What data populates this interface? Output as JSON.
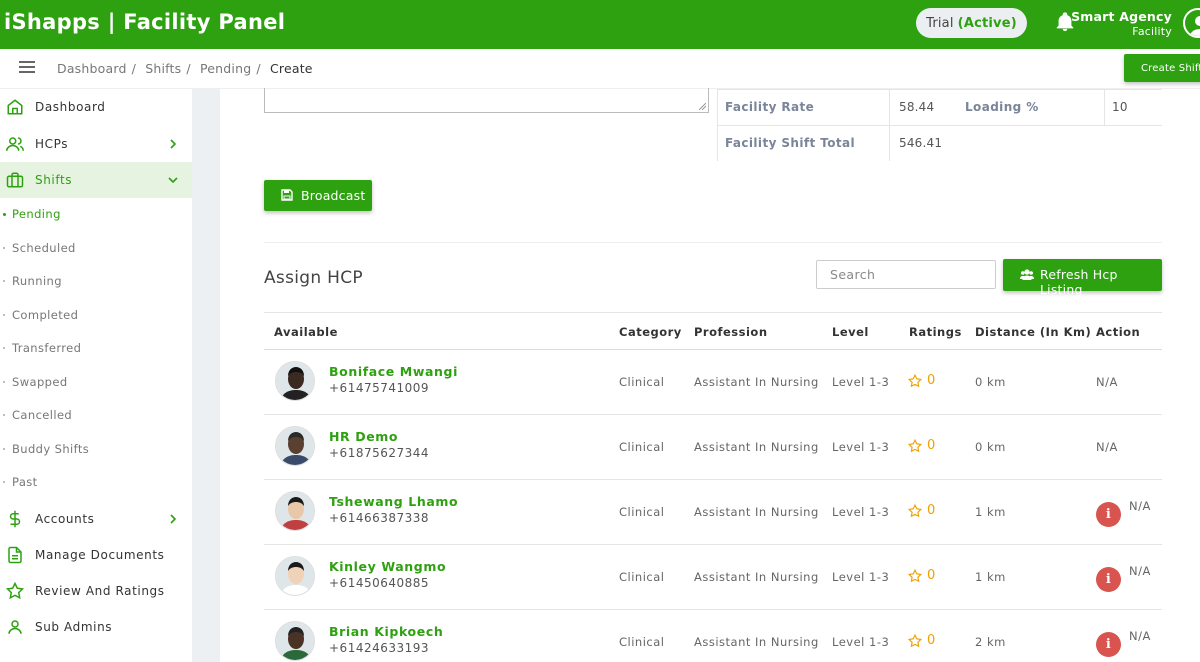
{
  "header": {
    "brand": "iShapps | Facility Panel",
    "trial_label": "Trial",
    "trial_status": "(Active)",
    "agency_name": "Smart Agency",
    "agency_role": "Facility",
    "brand_color": "#2ea110"
  },
  "breadcrumb": {
    "items": [
      "Dashboard",
      "Shifts",
      "Pending",
      "Create"
    ],
    "create_shift": "Create Shift"
  },
  "sidebar": {
    "items": [
      {
        "label": "Dashboard",
        "icon": "home-icon"
      },
      {
        "label": "HCPs",
        "icon": "users-icon"
      },
      {
        "label": "Shifts",
        "icon": "briefcase-icon"
      },
      {
        "label": "Accounts",
        "icon": "dollar-icon"
      },
      {
        "label": "Manage Documents",
        "icon": "document-icon"
      },
      {
        "label": "Review And Ratings",
        "icon": "star-icon"
      },
      {
        "label": "Sub Admins",
        "icon": "user-icon"
      }
    ],
    "shift_sub": [
      "Pending",
      "Scheduled",
      "Running",
      "Completed",
      "Transferred",
      "Swapped",
      "Cancelled",
      "Buddy Shifts",
      "Past"
    ]
  },
  "rates": {
    "facility_rate_label": "Facility Rate",
    "facility_rate": "58.44",
    "loading_label": "Loading %",
    "loading": "10",
    "total_label": "Facility Shift Total",
    "total": "546.41"
  },
  "broadcast_label": "Broadcast",
  "assign": {
    "title": "Assign HCP",
    "search_placeholder": "Search",
    "refresh_label": "Refresh Hcp Listing",
    "columns": [
      "Available",
      "Category",
      "Profession",
      "Level",
      "Ratings",
      "Distance (In Km)",
      "Action"
    ],
    "rows": [
      {
        "name": "Boniface Mwangi",
        "phone": "+61475741009",
        "category": "Clinical",
        "profession": "Assistant In Nursing",
        "level": "Level 1-3",
        "rating": "0",
        "distance": "0 km",
        "action": "N/A",
        "has_info": false
      },
      {
        "name": "HR Demo",
        "phone": "+61875627344",
        "category": "Clinical",
        "profession": "Assistant In Nursing",
        "level": "Level 1-3",
        "rating": "0",
        "distance": "0 km",
        "action": "N/A",
        "has_info": false
      },
      {
        "name": "Tshewang Lhamo",
        "phone": "+61466387338",
        "category": "Clinical",
        "profession": "Assistant In Nursing",
        "level": "Level 1-3",
        "rating": "0",
        "distance": "1 km",
        "action": "N/A",
        "has_info": true
      },
      {
        "name": "Kinley Wangmo",
        "phone": "+61450640885",
        "category": "Clinical",
        "profession": "Assistant In Nursing",
        "level": "Level 1-3",
        "rating": "0",
        "distance": "1 km",
        "action": "N/A",
        "has_info": true
      },
      {
        "name": "Brian Kipkoech",
        "phone": "+61424633193",
        "category": "Clinical",
        "profession": "Assistant In Nursing",
        "level": "Level 1-3",
        "rating": "0",
        "distance": "2 km",
        "action": "N/A",
        "has_info": true
      }
    ]
  }
}
